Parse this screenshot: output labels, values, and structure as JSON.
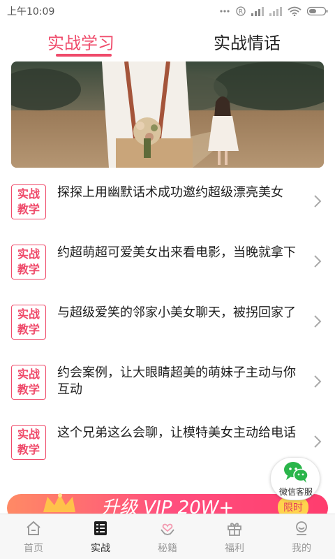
{
  "status_bar": {
    "time": "上午10:09",
    "icons": [
      "dots-icon",
      "registered-icon",
      "signal-icon",
      "signal-icon",
      "wifi-icon",
      "battery-icon"
    ]
  },
  "tabs": {
    "active": "实战学习",
    "inactive": "实战情话",
    "accent": "#ef4a6a"
  },
  "banner": {
    "image": "couple-outdoor-photo"
  },
  "articles": [
    {
      "badge_line1": "实战",
      "badge_line2": "教学",
      "title": "探探上用幽默话术成功邀约超级漂亮美女"
    },
    {
      "badge_line1": "实战",
      "badge_line2": "教学",
      "title": "约超萌超可爱美女出来看电影，当晚就拿下"
    },
    {
      "badge_line1": "实战",
      "badge_line2": "教学",
      "title": "与超级爱笑的邻家小美女聊天，被拐回家了"
    },
    {
      "badge_line1": "实战",
      "badge_line2": "教学",
      "title": "约会案例，让大眼睛超美的萌妹子主动与你互动"
    },
    {
      "badge_line1": "实战",
      "badge_line2": "教学",
      "title": "这个兄弟这么会聊，让模特美女主动给电话"
    }
  ],
  "promo": {
    "text": "升级 VIP 20W+",
    "tag": "限时"
  },
  "wechat": {
    "label": "微信客服"
  },
  "bottom_nav": {
    "items": [
      {
        "label": "首页",
        "icon": "home-icon"
      },
      {
        "label": "实战",
        "icon": "list-icon"
      },
      {
        "label": "秘籍",
        "icon": "heart-hands-icon"
      },
      {
        "label": "福利",
        "icon": "gift-icon"
      },
      {
        "label": "我的",
        "icon": "profile-icon"
      }
    ],
    "active_label": "实战"
  }
}
